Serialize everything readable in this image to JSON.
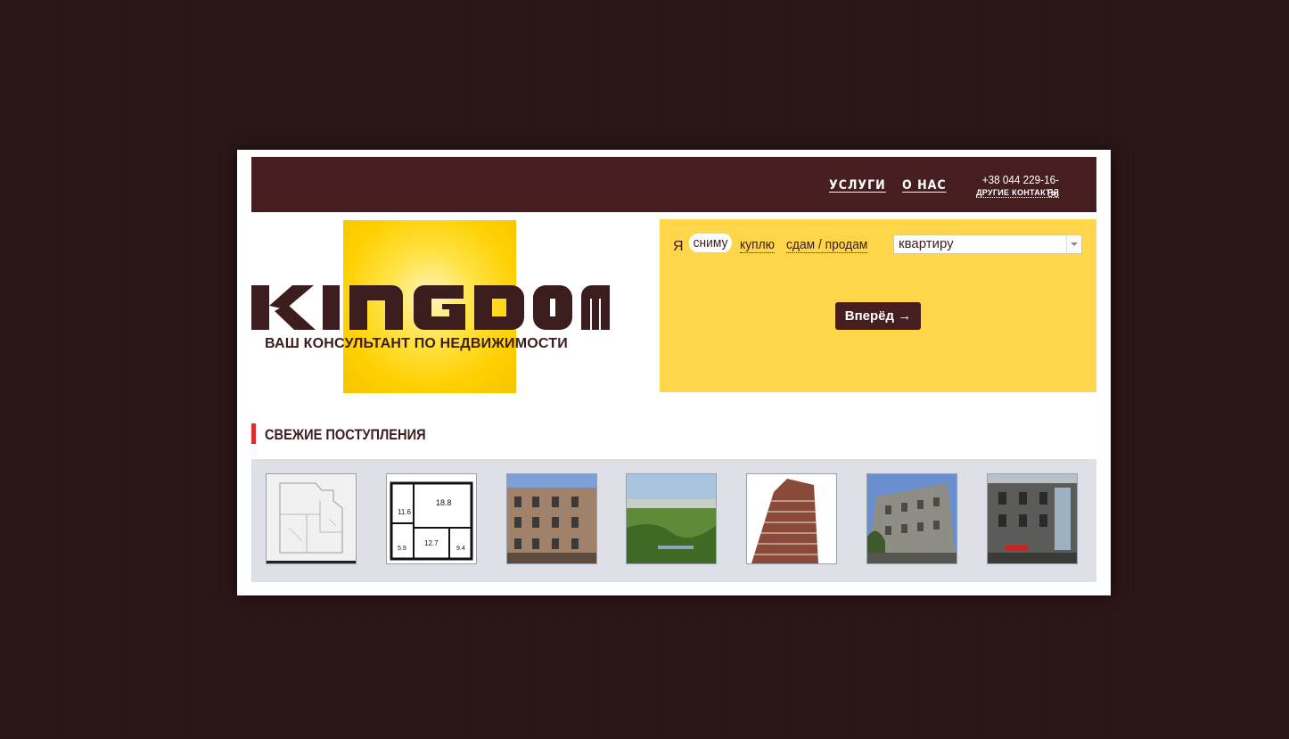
{
  "header": {
    "nav": [
      {
        "label": "УСЛУГИ"
      },
      {
        "label": "О НАС"
      }
    ],
    "phone": "+38 044 229-16-86",
    "contacts_link": "ДРУГИЕ КОНТАКТЫ"
  },
  "logo": {
    "wordmark": "KINGDOM",
    "tagline": "ВАШ КОНСУЛЬТАНТ ПО НЕДВИЖИМОСТИ"
  },
  "search": {
    "prefix": "Я",
    "options": [
      {
        "label": "сниму",
        "selected": true
      },
      {
        "label": "куплю",
        "selected": false
      },
      {
        "label": "сдам / продам",
        "selected": false
      }
    ],
    "property_type": "квартиру",
    "submit_label": "Вперёд →"
  },
  "fresh": {
    "title": "СВЕЖИЕ ПОСТУПЛЕНИЯ",
    "items": [
      {
        "icon": "floor-plan-image"
      },
      {
        "icon": "floor-plan-image"
      },
      {
        "icon": "building-photo"
      },
      {
        "icon": "city-view-photo"
      },
      {
        "icon": "highrise-photo"
      },
      {
        "icon": "building-photo"
      },
      {
        "icon": "building-photo"
      }
    ]
  },
  "colors": {
    "background": "#2a1517",
    "header_bar": "#461e20",
    "search_panel": "#ffd54a",
    "accent_red": "#e12a2a",
    "logo_yellow": "#ffd000",
    "gallery_bg": "#dde0e6"
  }
}
